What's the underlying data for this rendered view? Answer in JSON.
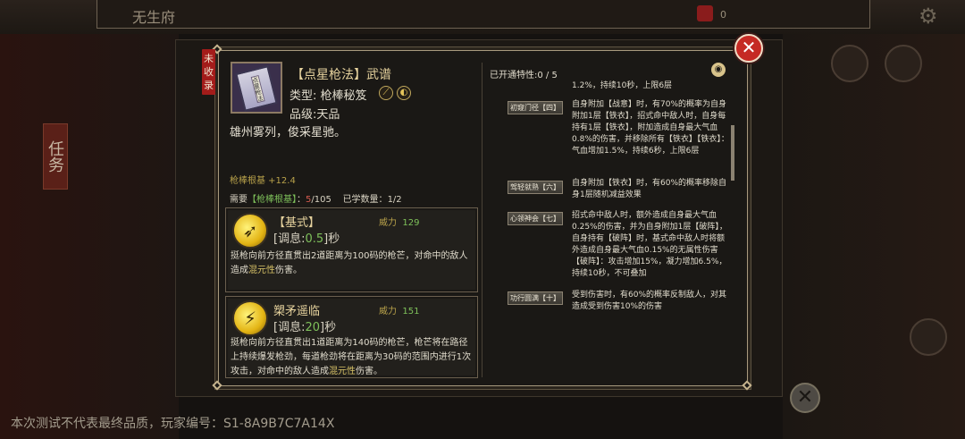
{
  "background": {
    "location_title": "无生府",
    "currency_count": "0",
    "task_tab": "任务"
  },
  "footer": "本次测试不代表最终品质，玩家编号：S1-8A9B7C7A14X",
  "dialog": {
    "status_tag": "未收录",
    "manual": {
      "name": "【点星枪法】武谱",
      "type_label": "类型:",
      "type_value": "枪棒秘笈",
      "grade_label": "品级:",
      "grade_value": "天品",
      "poem": "雄州雾列，俊采星驰。",
      "cover_text": "点星枪法",
      "base_bonus": "枪棒根基 +12.4",
      "req_prefix": "需要",
      "req_stat": "【枪棒根基】",
      "req_sep": "：",
      "req_current": "5",
      "req_total": "/105",
      "learned_label": "已学数量：",
      "learned_value": "1/2"
    },
    "skills": [
      {
        "name": "【基式】",
        "power_label": "威力",
        "power_value": "129",
        "cd_prefix": "[调息:",
        "cd_value": "0.5",
        "cd_suffix": "]秒",
        "desc_main": "挺枪向前方径直贯出2道距离为100码的枪芒，对命中的敌人造成",
        "desc_element": "混元性",
        "desc_end": "伤害。"
      },
      {
        "name": "槊矛遥临",
        "power_label": "威力",
        "power_value": "151",
        "cd_prefix": "[调息:",
        "cd_value": "20",
        "cd_suffix": "]秒",
        "desc_main": "挺枪向前方径直贯出1道距离为140码的枪芒，枪芒将在路径上持续爆发枪劲，每道枪劲将在距离为30码的范围内进行1次攻击，对命中的敌人造成",
        "desc_element": "混元性",
        "desc_end": "伤害。"
      }
    ],
    "traits": {
      "header": "已开通特性:0 / 5",
      "partial_text": "1.2%，持续10秒，上限6层",
      "items": [
        {
          "button": "初窥门径【四】",
          "text": "自身附加【战意】时，有70%的概率为自身附加1层【铁衣】，招式命中敌人时，自身每持有1层【铁衣】，附加造成自身最大气血0.8%的伤害，并移除所有【铁衣】【铁衣】：气血增加1.5%，持续6秒，上限6层"
        },
        {
          "button": "驾轻就熟【六】",
          "text": "自身附加【铁衣】时，有60%的概率移除自身1层随机减益效果"
        },
        {
          "button": "心领神会【七】",
          "text": "招式命中敌人时，额外造成自身最大气血0.25%的伤害，并为自身附加1层【破阵】，自身持有【破阵】时，基式命中敌人时将额外造成自身最大气血0.15%的无属性伤害【破阵】：攻击增加15%，凝力增加6.5%，持续10秒，不可叠加"
        },
        {
          "button": "功行圆满【十】",
          "text": "受到伤害时，有60%的概率反制敌人，对其造成受到伤害10%的伤害"
        }
      ]
    }
  }
}
